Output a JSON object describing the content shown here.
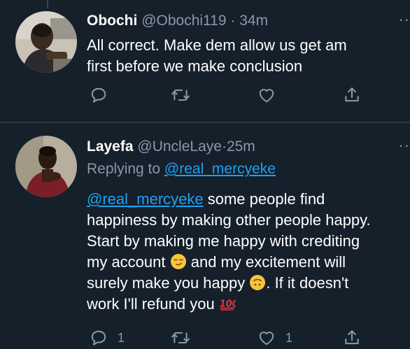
{
  "tweets": [
    {
      "name": "Obochi",
      "handle": "@Obochi119",
      "separator": "·",
      "time": "34m",
      "lines": [
        "All correct. Make dem allow us get am",
        "first before we make conclusion"
      ],
      "actions": {
        "reply_count": "",
        "retweet_count": "",
        "like_count": ""
      },
      "more_icon": "more-dots-icon"
    },
    {
      "name": "Layefa",
      "handle": "@UncleLaye",
      "separator": "·",
      "time": "25m",
      "replying_label": "Replying to",
      "replying_to": "@real_mercyeke",
      "mention": "@real_mercyeke",
      "line1_rest": " some people find",
      "line2": "happiness by making other people happy.",
      "line3": "Start by making me happy with crediting",
      "line4_a": "my account ",
      "line4_b": " and my excitement will",
      "line5_a": "surely make you happy ",
      "line5_b": ". If it doesn't",
      "line6_a": "work I'll refund you ",
      "actions": {
        "reply_count": "1",
        "retweet_count": "",
        "like_count": "1"
      },
      "more_icon": "more-dots-icon"
    }
  ],
  "colors": {
    "background": "#15202b",
    "text": "#ffffff",
    "secondary": "#8899a6",
    "link": "#1da1f2"
  }
}
